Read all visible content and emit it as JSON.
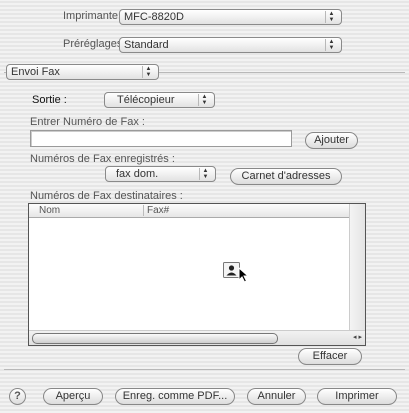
{
  "printer": {
    "label": "Imprimante :",
    "value": "MFC-8820D"
  },
  "presets": {
    "label": "Préréglages :",
    "value": "Standard"
  },
  "section_menu": {
    "value": "Envoi Fax"
  },
  "output": {
    "label": "Sortie :",
    "value": "Télécopieur"
  },
  "fax_entry": {
    "label": "Entrer Numéro de Fax :",
    "value": "",
    "add_label": "Ajouter"
  },
  "saved": {
    "label": "Numéros de Fax enregistrés :",
    "value": "fax dom.",
    "address_book_label": "Carnet d'adresses"
  },
  "recipients": {
    "label": "Numéros de Fax destinataires :",
    "columns": [
      "Nom",
      "Fax#"
    ]
  },
  "erase_label": "Effacer",
  "footer": {
    "help": "?",
    "preview": "Aperçu",
    "save_pdf": "Enreg. comme PDF...",
    "cancel": "Annuler",
    "print": "Imprimer"
  },
  "icons": [
    "popup-arrows-icon",
    "address-card-icon",
    "cursor-arrow-icon",
    "scroll-arrows-icon",
    "help-icon"
  ]
}
